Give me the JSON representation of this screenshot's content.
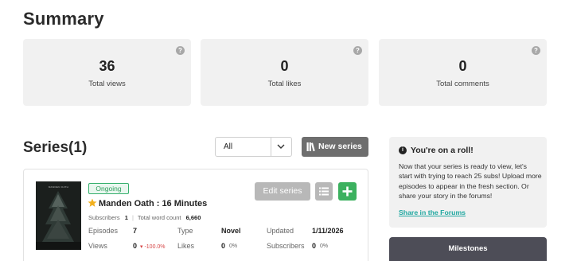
{
  "summary": {
    "title": "Summary",
    "cards": [
      {
        "value": "36",
        "label": "Total views"
      },
      {
        "value": "0",
        "label": "Total likes"
      },
      {
        "value": "0",
        "label": "Total comments"
      }
    ]
  },
  "series_section": {
    "title": "Series(1)",
    "filter": {
      "selected": "All"
    },
    "new_series_label": "New series"
  },
  "series_card": {
    "cover_title": "MANDEN OATH",
    "status": "Ongoing",
    "name": "Manden Oath : 16 Minutes",
    "subscribers_label": "Subscribers",
    "subscribers_value": "1",
    "word_count_label": "Total word count",
    "word_count_value": "6,660",
    "edit_label": "Edit series",
    "stats": {
      "episodes_label": "Episodes",
      "episodes_value": "7",
      "type_label": "Type",
      "type_value": "Novel",
      "updated_label": "Updated",
      "updated_value": "1/11/2026",
      "views_label": "Views",
      "views_value": "0",
      "views_delta": "▾ -100.0%",
      "likes_label": "Likes",
      "likes_value": "0",
      "likes_pct": "0%",
      "subs_label": "Subscribers",
      "subs_value": "0",
      "subs_pct": "0%"
    }
  },
  "roll_box": {
    "title": "You're on a roll!",
    "body": "Now that your series is ready to view, let's start with trying to reach 25 subs! Upload more episodes to appear in the fresh section. Or share your story in the forums!",
    "link": "Share in the Forums"
  },
  "milestones": {
    "title": "Milestones"
  },
  "colors": {
    "accent_green": "#3cb15f",
    "link_teal": "#1fa7a0",
    "negative_red": "#d64545",
    "dark_panel": "#4d4d57"
  }
}
